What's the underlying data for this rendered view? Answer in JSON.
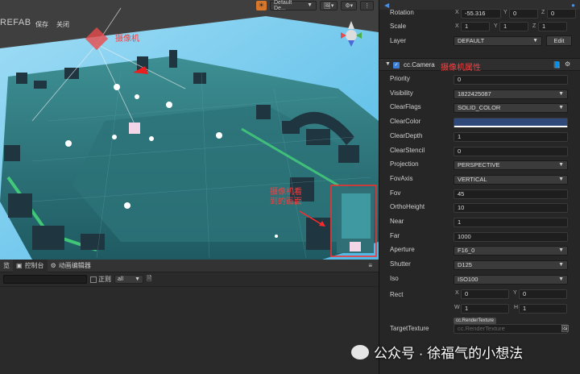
{
  "scene": {
    "prefab_label": "REFAB",
    "save_label": "保存",
    "close_label": "关闭",
    "layout_dropdown": "Default De...",
    "camera_note": "摄像机",
    "render_note": "摄像机看\n到的画面"
  },
  "console": {
    "tabs": [
      {
        "label": "览",
        "icon": ""
      },
      {
        "label": "控制台",
        "icon": "console-icon"
      },
      {
        "label": "动画编辑器",
        "icon": "animation-icon"
      }
    ],
    "regex_label": "正则",
    "level_value": "all",
    "menu_icon": "≡"
  },
  "inspector": {
    "rotation_label": "Rotation",
    "rotation_x": "-55.316",
    "rotation_y": "0",
    "rotation_z": "0",
    "scale_label": "Scale",
    "scale_x": "1",
    "scale_y": "1",
    "scale_z": "1",
    "layer_label": "Layer",
    "layer_value": "DEFAULT",
    "edit_label": "Edit",
    "component_name": "cc.Camera",
    "component_note": "摄像机属性",
    "props": [
      {
        "key": "Priority",
        "value": "0",
        "type": "input"
      },
      {
        "key": "Visibility",
        "value": "1822425087",
        "type": "select"
      },
      {
        "key": "ClearFlags",
        "value": "SOLID_COLOR",
        "type": "select"
      },
      {
        "key": "ClearColor",
        "value": "",
        "type": "color"
      },
      {
        "key": "ClearDepth",
        "value": "1",
        "type": "input"
      },
      {
        "key": "ClearStencil",
        "value": "0",
        "type": "input"
      },
      {
        "key": "Projection",
        "value": "PERSPECTIVE",
        "type": "select"
      },
      {
        "key": "FovAxis",
        "value": "VERTICAL",
        "type": "select"
      },
      {
        "key": "Fov",
        "value": "45",
        "type": "input"
      },
      {
        "key": "OrthoHeight",
        "value": "10",
        "type": "input"
      },
      {
        "key": "Near",
        "value": "1",
        "type": "input"
      },
      {
        "key": "Far",
        "value": "1000",
        "type": "input"
      },
      {
        "key": "Aperture",
        "value": "F16_0",
        "type": "select"
      },
      {
        "key": "Shutter",
        "value": "D125",
        "type": "select"
      },
      {
        "key": "Iso",
        "value": "ISO100",
        "type": "select"
      }
    ],
    "rect_label": "Rect",
    "rect_x": "0",
    "rect_y": "0",
    "rect_w": "1",
    "rect_h": "1",
    "target_label": "TargetTexture",
    "target_tag": "cc.RenderTexture",
    "target_placeholder": "cc.RenderTexture",
    "clear_color_hex": "#2f4a7a"
  },
  "watermark": "公众号 · 徐福气的小想法"
}
